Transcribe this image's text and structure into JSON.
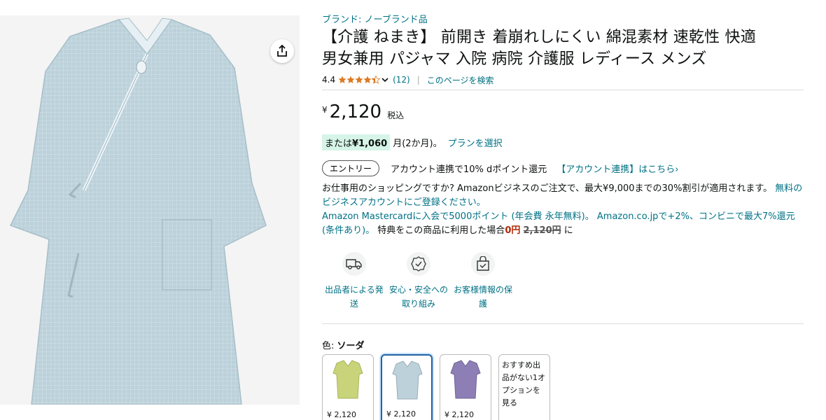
{
  "image": {
    "share_icon": "share-icon",
    "color": "#bcd1da"
  },
  "brand": "ブランド: ノーブランド品",
  "title_line1": "【介護 ねまき】 前開き 着崩れしにくい 綿混素材 速乾性 快適",
  "title_line2": "男女兼用 パジャマ 入院 病院 介護服 レディース メンズ",
  "rating": {
    "value": "4.4",
    "stars": 4.4,
    "count": "(12)",
    "separator": "|",
    "search_link": "このページを検索"
  },
  "price": {
    "symbol": "¥",
    "value": "2,120",
    "tax": "税込"
  },
  "installment": {
    "prefix": "または",
    "amount": "¥1,060",
    "months": "月(2か月)。",
    "plan_link": "プランを選択"
  },
  "entry": {
    "button": "エントリー",
    "text": "アカウント連携で10% dポイント還元",
    "link": "【アカウント連携】はこちら›"
  },
  "business": {
    "text": "お仕事用のショッピングですか? Amazonビジネスのご注文で、最大¥9,000までの30%割引が適用されます。",
    "link": "無料のビジネスアカウントにご登録ください。"
  },
  "mastercard": {
    "part1": "Amazon Mastercardに入会で5000ポイント (年会費 永年無料)。 Amazon.co.jpで+2%、コンビニで最大7%還元(条件あり)。",
    "part2": "特典をこの商品に利用した場合",
    "zero": "0円",
    "strike": "2,120円",
    "suffix": "に"
  },
  "features": [
    {
      "icon": "truck-icon",
      "label": "出品者による発送"
    },
    {
      "icon": "shield-badge-icon",
      "label": "安心・安全への取り組み"
    },
    {
      "icon": "lock-bag-icon",
      "label": "お客様情報の保護"
    }
  ],
  "color": {
    "label": "色:",
    "value": "ソーダ"
  },
  "swatches": [
    {
      "name": "yellow-green",
      "color": "#c9d47a",
      "price": "¥ 2,120"
    },
    {
      "name": "soda",
      "color": "#bcd1da",
      "price": "¥ 2,120"
    },
    {
      "name": "purple",
      "color": "#8d7fb5",
      "price": "¥ 2,120"
    }
  ],
  "other_option": "おすすめ出品がない1オプションを見る"
}
